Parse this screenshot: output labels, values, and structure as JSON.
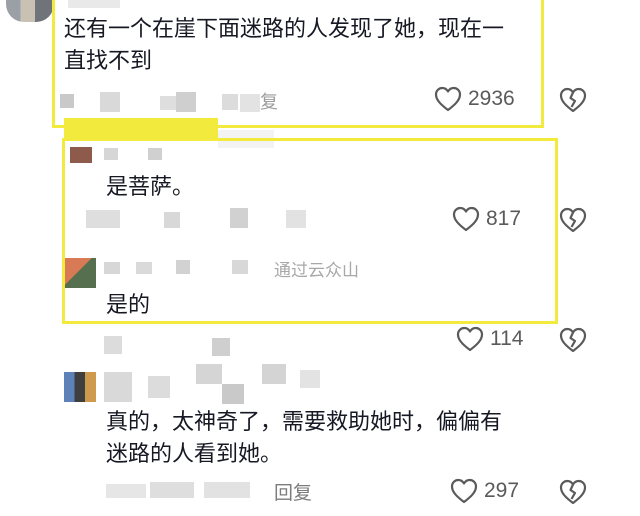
{
  "comments": [
    {
      "text": "还有一个在崖下面迷路的人发现了她，现在一直找不到",
      "text_line1": "还有一个在崖下面迷路的人发现了她，现在一",
      "text_line2": "直找不到",
      "meta_fragment": "复",
      "likes": "2936"
    },
    {
      "text": "是菩萨。",
      "likes": "817"
    },
    {
      "meta_fragment": "通过云众山",
      "text": "是的",
      "likes": "114"
    },
    {
      "text": "真的，太神奇了，需要救助她时，偏偏有迷路的人看到她。",
      "text_line1": "真的，太神奇了，需要救助她时，偏偏有",
      "text_line2": "迷路的人看到她。",
      "reply_label": "回复",
      "likes": "297"
    }
  ],
  "icons": {
    "like": "heart-outline-icon",
    "dislike": "broken-heart-icon"
  },
  "colors": {
    "highlight": "#f2ea3d",
    "text": "#161823",
    "count": "#5a5a5a"
  }
}
